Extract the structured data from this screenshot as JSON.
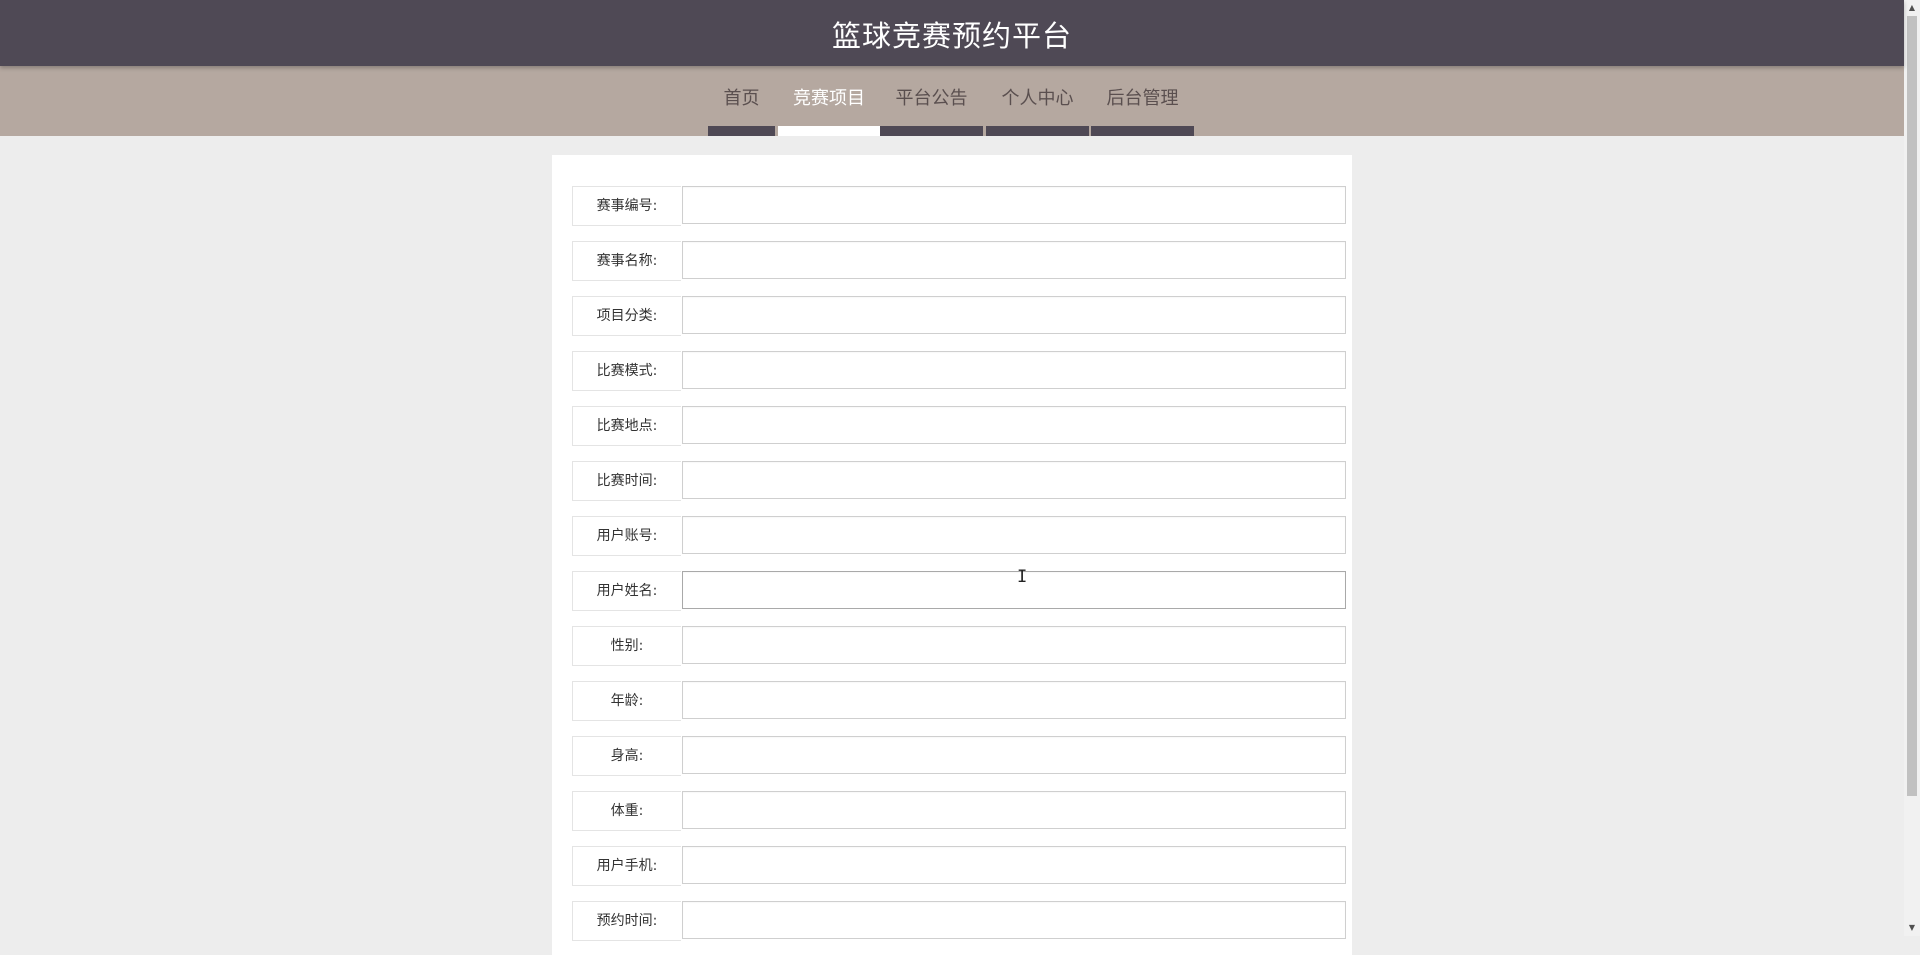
{
  "header": {
    "title": "篮球竞赛预约平台"
  },
  "nav": {
    "items": [
      {
        "label": "首页",
        "active": false
      },
      {
        "label": "竞赛项目",
        "active": true
      },
      {
        "label": "平台公告",
        "active": false
      },
      {
        "label": "个人中心",
        "active": false
      },
      {
        "label": "后台管理",
        "active": false
      }
    ]
  },
  "form": {
    "fields": [
      {
        "label": "赛事编号:",
        "value": ""
      },
      {
        "label": "赛事名称:",
        "value": ""
      },
      {
        "label": "项目分类:",
        "value": ""
      },
      {
        "label": "比赛模式:",
        "value": ""
      },
      {
        "label": "比赛地点:",
        "value": ""
      },
      {
        "label": "比赛时间:",
        "value": ""
      },
      {
        "label": "用户账号:",
        "value": ""
      },
      {
        "label": "用户姓名:",
        "value": ""
      },
      {
        "label": "性别:",
        "value": ""
      },
      {
        "label": "年龄:",
        "value": ""
      },
      {
        "label": "身高:",
        "value": ""
      },
      {
        "label": "体重:",
        "value": ""
      },
      {
        "label": "用户手机:",
        "value": ""
      },
      {
        "label": "预约时间:",
        "value": ""
      }
    ]
  },
  "colors": {
    "header_bg": "#4f4955",
    "nav_bg": "#b5a8a0",
    "page_bg": "#ededed",
    "active_indicator": "#ffffff"
  },
  "icons": {
    "scroll_up": "▲",
    "scroll_down": "▼",
    "text_cursor": "I"
  }
}
